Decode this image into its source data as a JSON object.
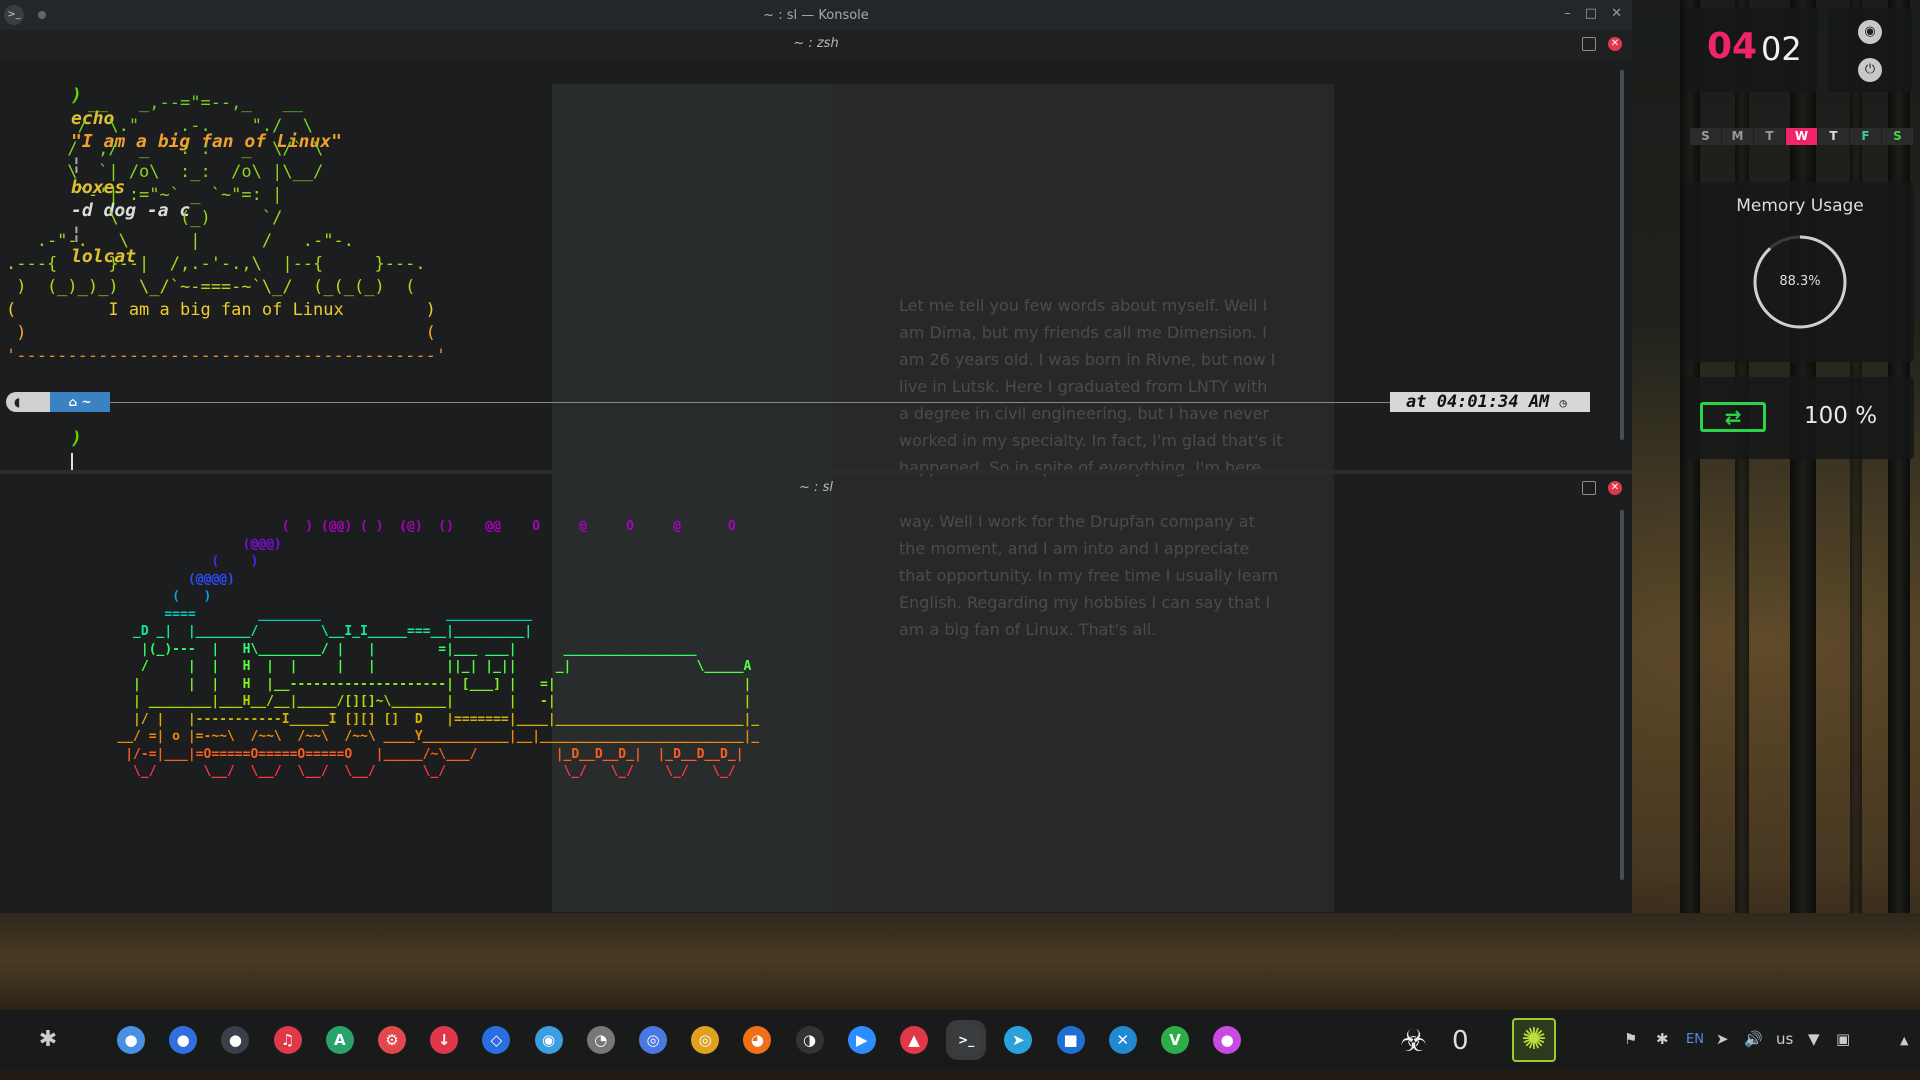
{
  "window": {
    "title": "~ : sl — Konsole"
  },
  "top_pane": {
    "title": "~ : zsh",
    "command": {
      "prompt": ")",
      "echo": "echo",
      "string": "\"I am a big fan of Linux\"",
      "pipe": "¦",
      "boxes": "boxes",
      "boxes_args": "-d dog -a c",
      "lolcat": "lolcat"
    },
    "output_lines": [
      "        __   _,--=\"=--,_   __",
      "       /  \\.\"    .-.    \"./  \\",
      "      /  ,/  _   : :   _  \\/` \\",
      "      \\  `| /o\\  :_:  /o\\ |\\__/",
      "       `-'| :=\"~` _ `~\"=: |",
      "          \\`     (_)     `/",
      "   .-\"-.   \\      |      /   .-\"-.",
      ".---{     }--|  /,.-'-.,\\  |--{     }---.",
      " )  (_)_)_)  \\_/`~-===-~`\\_/  (_(_(_)  (",
      "(         I am a big fan of Linux        )",
      " )                                       (",
      "'-----------------------------------------'"
    ],
    "status": {
      "home": "⌂ ~",
      "time": "at 04:01:34 AM"
    },
    "prompt_char": ")"
  },
  "bottom_pane": {
    "title": "~ : sl",
    "smoke": [
      "                                    (  ) (@@) ( )  (@)  ()    @@    O     @     O     @      O",
      "                               (@@@)",
      "                           (    )",
      "                        (@@@@)",
      "",
      "                      (   )",
      "                     ====        ________                ___________",
      "                 _D _|  |_______/        \\__I_I_____===__|_________|",
      "                  |(_)---  |   H\\________/ |   |        =|___ ___|      _________________",
      "                  /     |  |   H  |  |     |   |         ||_| |_||     _|                \\_____A",
      "                 |      |  |   H  |__--------------------| [___] |   =|                        |",
      "                 | ________|___H__/__|_____/[][]~\\_______|       |   -|                        |",
      "                 |/ |   |-----------I_____I [][] []  D   |=======|____|________________________|_",
      "               __/ =| o |=-~~\\  /~~\\  /~~\\  /~~\\ ____Y___________|__|__________________________|_",
      "                |/-=|___|=O=====O=====O=====O   |_____/~\\___/          |_D__D__D_|  |_D__D__D_|",
      "                 \\_/      \\__/  \\__/  \\__/  \\__/      \\_/               \\_/   \\_/    \\_/   \\_/"
    ]
  },
  "ghost_chat": {
    "messages": [
      "Let me tell you few words about myself. Well I",
      "am Dima, but my friends call me Dimension. I",
      "am 26 years old. I was born in Rivne, but now I",
      "live in Lutsk. Here I graduated from LNTY with",
      "a degree in civil engineering, but I have never",
      "worked in my specialty. In fact, I'm glad that's it",
      "happened. So in spite of everything, I'm here",
      "",
      "way. Well I work for the Drupfan company at",
      "the moment, and I am into and I appreciate",
      "that opportunity. In my free time I usually learn",
      "English. Regarding my hobbies I can say that I",
      "am a big fan of Linux. That's all."
    ]
  },
  "clock": {
    "hours": "04",
    "minutes": "02"
  },
  "calendar": {
    "days": [
      "S",
      "M",
      "T",
      "W",
      "T",
      "F",
      "S"
    ],
    "active_index": 3
  },
  "memory": {
    "title": "Memory Usage",
    "percent_label": "88.3%",
    "fraction": 0.883
  },
  "battery": {
    "label": "100 %"
  },
  "taskbar": {
    "apps": [
      {
        "name": "app-finder-icon",
        "glyph": "●",
        "color": "#4a90e2"
      },
      {
        "name": "messenger-icon",
        "glyph": "●",
        "color": "#2f6fe0"
      },
      {
        "name": "terminal-dark-icon",
        "glyph": "●",
        "color": "#3a3f4a"
      },
      {
        "name": "headphones-icon",
        "glyph": "♫",
        "color": "#e0384b"
      },
      {
        "name": "arch-icon",
        "glyph": "A",
        "color": "#29a36a"
      },
      {
        "name": "tweaks-icon",
        "glyph": "⚙",
        "color": "#e0484b"
      },
      {
        "name": "download-icon",
        "glyph": "↓",
        "color": "#e0384b"
      },
      {
        "name": "dropbox-icon",
        "glyph": "◇",
        "color": "#2a6fe0"
      },
      {
        "name": "compass-icon",
        "glyph": "◉",
        "color": "#3a9ee0"
      },
      {
        "name": "gimp-icon",
        "glyph": "◔",
        "color": "#777777"
      },
      {
        "name": "chromium-icon",
        "glyph": "◎",
        "color": "#4a78e0"
      },
      {
        "name": "chrome-icon",
        "glyph": "◎",
        "color": "#e0a020"
      },
      {
        "name": "firefox-icon",
        "glyph": "◕",
        "color": "#f0701a"
      },
      {
        "name": "steam-icon",
        "glyph": "◑",
        "color": "#333333"
      },
      {
        "name": "zoom-icon",
        "glyph": "▶",
        "color": "#2d8cff"
      },
      {
        "name": "pdf-icon",
        "glyph": "▲",
        "color": "#e0384b"
      },
      {
        "name": "konsole-icon",
        "glyph": ">_",
        "color": "#3a3d40"
      },
      {
        "name": "telegram-icon",
        "glyph": "➤",
        "color": "#2aa1da"
      },
      {
        "name": "virtualbox-icon",
        "glyph": "■",
        "color": "#1e6fd0"
      },
      {
        "name": "vscode-icon",
        "glyph": "✕",
        "color": "#1f8ad2"
      },
      {
        "name": "vim-icon",
        "glyph": "V",
        "color": "#2bae4a"
      },
      {
        "name": "color-picker-icon",
        "glyph": "●",
        "color": "#c84ae0"
      }
    ],
    "counter": "0",
    "tray": {
      "lang": "EN",
      "layout": "us"
    }
  },
  "colors": {
    "accent": "#f0246a",
    "battery": "#2bd34a",
    "cursor": "#5fd700"
  }
}
